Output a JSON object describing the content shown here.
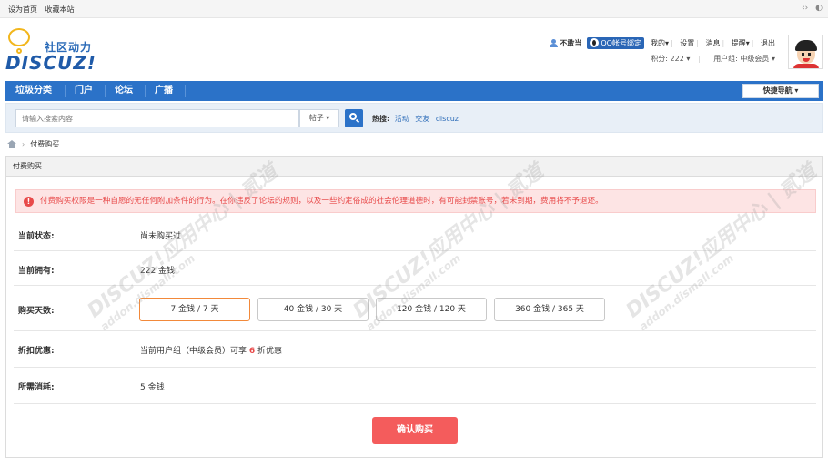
{
  "topbar": {
    "links": [
      "设为首页",
      "收藏本站"
    ],
    "tools": [
      "‹›",
      "◐"
    ]
  },
  "logo": {
    "sub": "社区动力",
    "main": "DISCUZ!"
  },
  "user": {
    "name": "不敢当",
    "qq_bind": "QQ帐号绑定",
    "nav": [
      "我的",
      "设置",
      "消息",
      "提醒",
      "退出"
    ],
    "points": "积分: 222",
    "group": "用户组: 中级会员"
  },
  "navbar": {
    "items": [
      "垃圾分类",
      "门户",
      "论坛",
      "广播"
    ],
    "quick_nav": "快捷导航"
  },
  "search": {
    "placeholder": "请输入搜索内容",
    "type": "帖子",
    "hot_label": "热搜:",
    "hot": [
      "活动",
      "交友",
      "discuz"
    ]
  },
  "breadcrumb": {
    "current": "付费购买"
  },
  "panel": {
    "title": "付费购买",
    "notice": "付费购买权限是一种自愿的无任何附加条件的行为。在你违反了论坛的规则，以及一些约定俗成的社会伦理道德时，有可能封禁账号，若未到期，费用将不予退还。",
    "rows": {
      "status": {
        "label": "当前状态:",
        "value": "尚未购买过"
      },
      "owned": {
        "label": "当前拥有:",
        "value": "222 金钱"
      },
      "days": {
        "label": "购买天数:"
      },
      "discount": {
        "label": "折扣优惠:",
        "prefix": "当前用户组（中级会员）可享",
        "rate": "6",
        "suffix": "折优惠"
      },
      "cost": {
        "label": "所需消耗:",
        "value": "5 金钱"
      }
    },
    "options": [
      "7 金钱 / 7 天",
      "40 金钱 / 30 天",
      "120 金钱 / 120 天",
      "360 金钱 / 365 天"
    ],
    "selected_option": 0,
    "confirm": "确认购买"
  },
  "watermark": {
    "main": "DISCUZ!应用中心 | 贰道",
    "sub": "addon.dismall.com"
  },
  "colors": {
    "nav_blue": "#2b72c8",
    "alert_red": "#e84a4a",
    "button_red": "#f45c5c",
    "selected_orange": "#f2893a"
  }
}
